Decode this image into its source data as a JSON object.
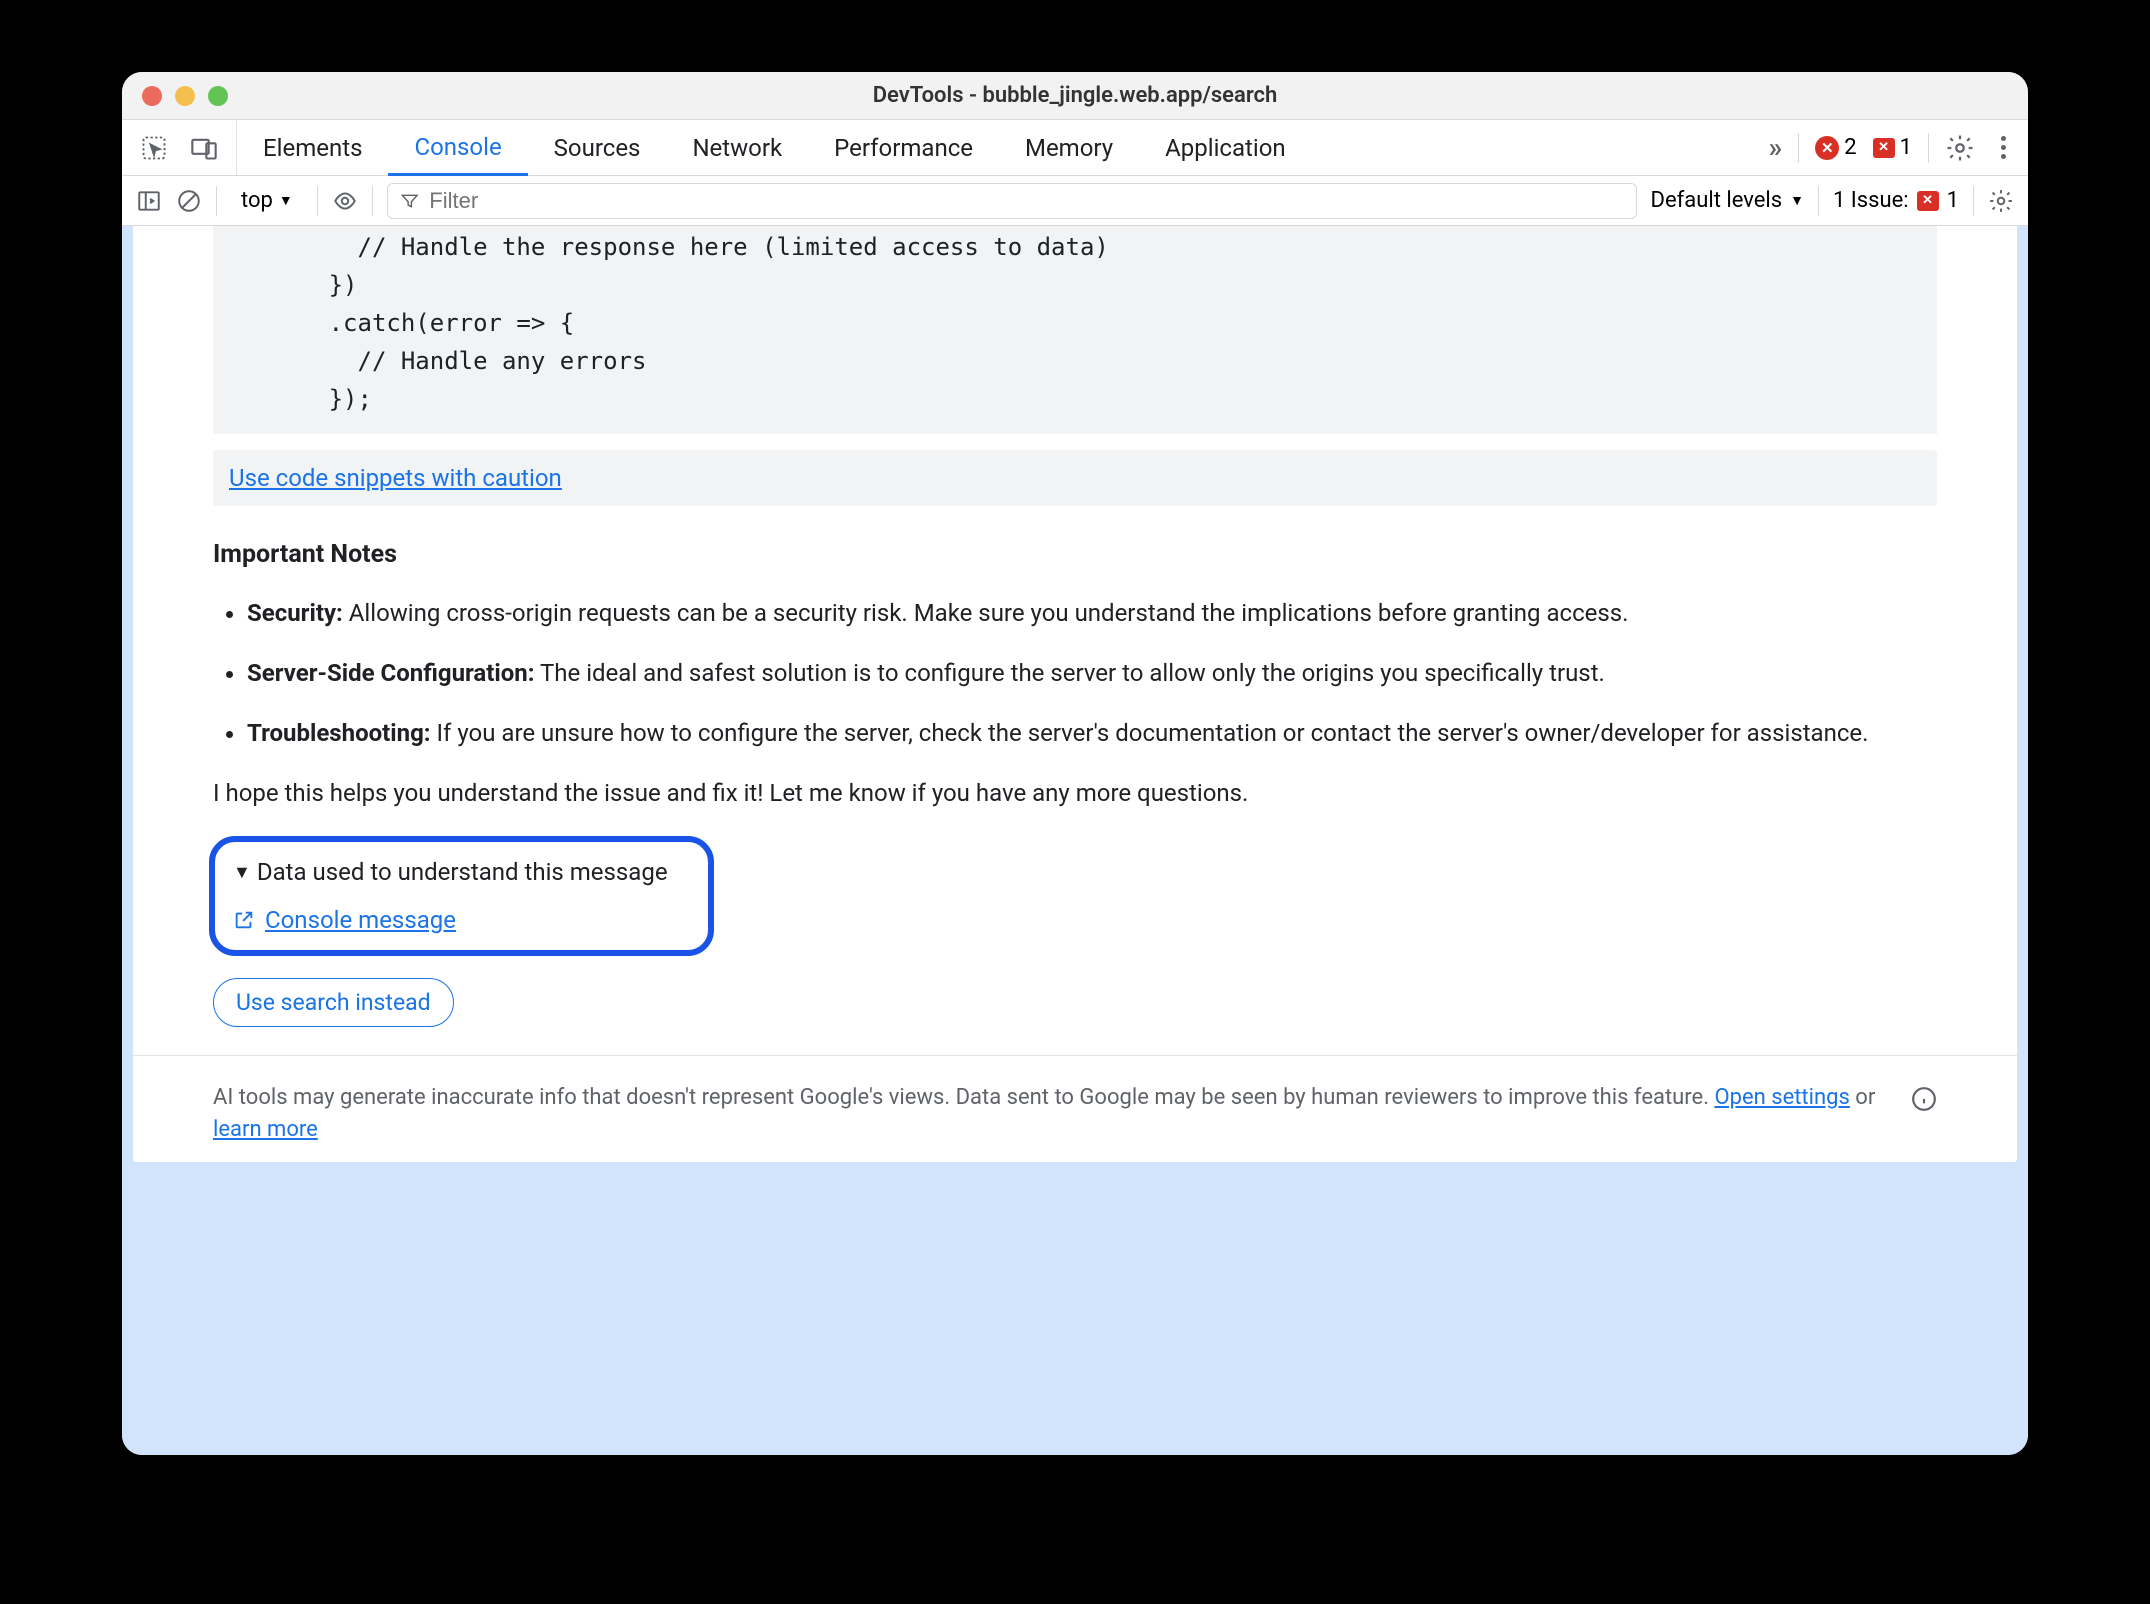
{
  "window": {
    "title": "DevTools - bubble_jingle.web.app/search"
  },
  "tabs": {
    "items": [
      "Elements",
      "Console",
      "Sources",
      "Network",
      "Performance",
      "Memory",
      "Application"
    ],
    "active": "Console",
    "overflow_icon": "»",
    "errors_count": "2",
    "issues_count": "1"
  },
  "filterbar": {
    "context": "top",
    "filter_placeholder": "Filter",
    "levels_label": "Default levels",
    "issue_label": "1 Issue:",
    "issue_count": "1"
  },
  "code": "          // Handle the response here (limited access to data)\n        })\n        .catch(error => {\n          // Handle any errors\n        });",
  "caution_link": "Use code snippets with caution",
  "notes": {
    "heading": "Important Notes",
    "items": [
      {
        "bold": "Security:",
        "text": " Allowing cross-origin requests can be a security risk. Make sure you understand the implications before granting access."
      },
      {
        "bold": "Server-Side Configuration:",
        "text": " The ideal and safest solution is to configure the server to allow only the origins you specifically trust."
      },
      {
        "bold": "Troubleshooting:",
        "text": " If you are unsure how to configure the server, check the server's documentation or contact the server's owner/developer for assistance."
      }
    ],
    "closing": "I hope this helps you understand the issue and fix it! Let me know if you have any more questions."
  },
  "data_callout": {
    "summary": "Data used to understand this message",
    "link": "Console message"
  },
  "chip": "Use search instead",
  "footer": {
    "text_before": "AI tools may generate inaccurate info that doesn't represent Google's views. Data sent to Google may be seen by human reviewers to improve this feature. ",
    "link1": "Open settings",
    "mid": " or ",
    "link2": "learn more"
  }
}
